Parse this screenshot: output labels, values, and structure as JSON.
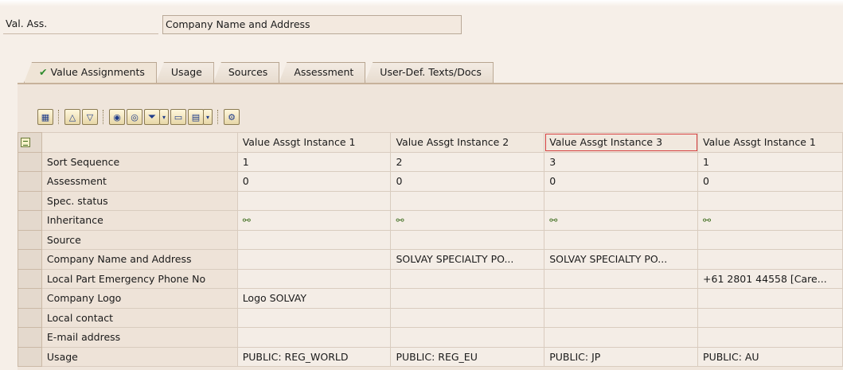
{
  "header": {
    "val_ass_label": "Val. Ass.",
    "val_ass_value": "Company Name and Address"
  },
  "tabs": [
    {
      "label": "Value Assignments",
      "active": true
    },
    {
      "label": "Usage",
      "active": false
    },
    {
      "label": "Sources",
      "active": false
    },
    {
      "label": "Assessment",
      "active": false
    },
    {
      "label": "User-Def. Texts/Docs",
      "active": false
    }
  ],
  "toolbar": {
    "icons": [
      "details-icon",
      "sort-ascending-icon",
      "sort-descending-icon",
      "find-icon",
      "find-next-icon",
      "filter-icon",
      "print-icon",
      "export-icon",
      "settings-icon"
    ]
  },
  "grid": {
    "columns": [
      "Value Assgt Instance 1",
      "Value Assgt Instance 2",
      "Value Assgt Instance 3",
      "Value Assgt Instance 1"
    ],
    "rows": [
      {
        "label": "Sort Sequence",
        "cells": [
          "1",
          "2",
          "3",
          "1"
        ]
      },
      {
        "label": "Assessment",
        "cells": [
          "0",
          "0",
          "0",
          "0"
        ]
      },
      {
        "label": "Spec. status",
        "cells": [
          "",
          "",
          "",
          ""
        ]
      },
      {
        "label": "Inheritance",
        "cells": [
          "inheritance-icon",
          "inheritance-icon",
          "inheritance-icon",
          "inheritance-icon"
        ]
      },
      {
        "label": "Source",
        "cells": [
          "",
          "",
          "",
          ""
        ]
      },
      {
        "label": "Company Name and Address",
        "cells": [
          "",
          "SOLVAY SPECIALTY PO...",
          "SOLVAY SPECIALTY PO...",
          ""
        ]
      },
      {
        "label": "Local Part Emergency Phone No",
        "cells": [
          "",
          "",
          "",
          "+61 2801 44558 [Care..."
        ]
      },
      {
        "label": "Company Logo",
        "cells": [
          "Logo SOLVAY",
          "",
          "",
          ""
        ]
      },
      {
        "label": "Local contact",
        "cells": [
          "",
          "",
          "",
          ""
        ]
      },
      {
        "label": "E-mail address",
        "cells": [
          "",
          "",
          "",
          ""
        ]
      },
      {
        "label": "Usage",
        "cells": [
          "PUBLIC: REG_WORLD",
          "PUBLIC: REG_EU",
          "PUBLIC: JP",
          "PUBLIC: AU"
        ]
      }
    ]
  }
}
